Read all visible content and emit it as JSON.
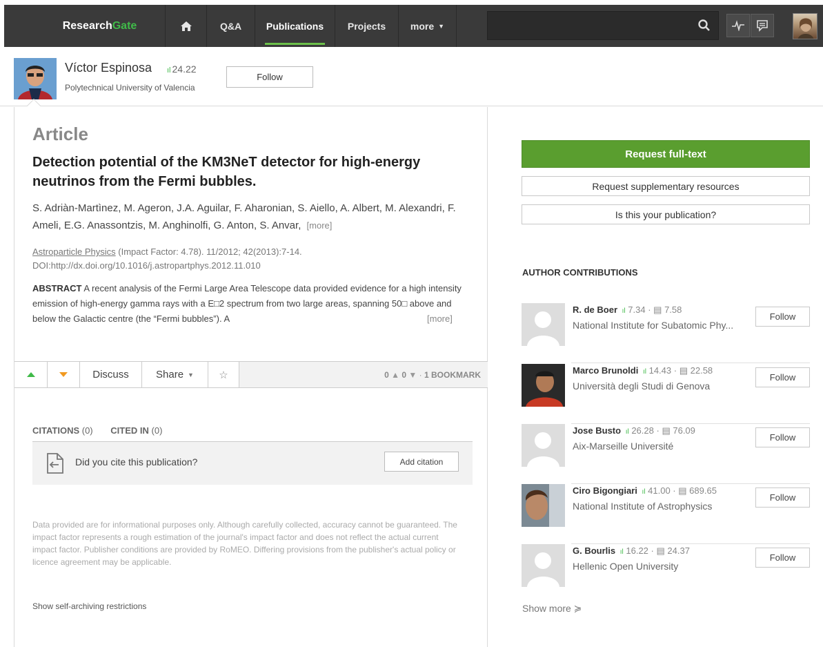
{
  "nav": {
    "brand_a": "Research",
    "brand_b": "Gate",
    "home_icon": "home-icon",
    "qa": "Q&A",
    "publications": "Publications",
    "projects": "Projects",
    "more": "more",
    "search_placeholder": ""
  },
  "profile": {
    "name": "Víctor Espinosa",
    "score": "24.22",
    "affiliation": "Polytechnical University of Valencia",
    "follow": "Follow"
  },
  "article": {
    "kind": "Article",
    "title": "Detection potential of the KM3NeT detector for high-energy neutrinos from the Fermi bubbles.",
    "authors": "S. Adriàn-Martìnez, M. Ageron, J.A. Aguilar, F. Aharonian, S. Aiello, A. Albert, M. Alexandri, F. Ameli, E.G. Anassontzis, M. Anghinolfi, G. Anton, S. Anvar,",
    "authors_more": "[more]",
    "journal_link": "Astroparticle Physics",
    "journal_rest": " (Impact Factor: 4.78). 11/2012; 42(2013):7-14.",
    "doi": "DOI:http://dx.doi.org/10.1016/j.astropartphys.2012.11.010",
    "abstract_label": "ABSTRACT",
    "abstract_text": " A recent analysis of the Fermi Large Area Telescope data provided evidence for a high intensity emission of high-energy gamma rays with a E□2 spectrum from two large areas, spanning 50□ above and below the Galactic centre (the “Fermi bubbles”). A",
    "abstract_more": "[more]"
  },
  "actions": {
    "discuss": "Discuss",
    "share": "Share",
    "up_count": "0",
    "down_count": "0",
    "bookmarks": "1 BOOKMARK"
  },
  "citations": {
    "tab1_label": "CITATIONS",
    "tab1_count": "(0)",
    "tab2_label": "CITED IN",
    "tab2_count": "(0)",
    "question": "Did you cite this publication?",
    "add": "Add citation"
  },
  "disclaimer": "Data provided are for informational purposes only. Although carefully collected, accuracy cannot be guaranteed. The impact factor represents a rough estimation of the journal's impact factor and does not reflect the actual current impact factor. Publisher conditions are provided by RoMEO. Differing provisions from the publisher's actual policy or licence agreement may be applicable.",
  "self_archiving": "Show self-archiving restrictions",
  "sidebar": {
    "request_full": "Request full-text",
    "request_supp": "Request supplementary resources",
    "is_yours": "Is this your publication?",
    "contrib_head": "AUTHOR CONTRIBUTIONS",
    "contributors": [
      {
        "name": "R. de Boer",
        "rg": "7.34",
        "pubs": "7.58",
        "affiliation": "National Institute for Subatomic Phy...",
        "follow": "Follow"
      },
      {
        "name": "Marco Brunoldi",
        "rg": "14.43",
        "pubs": "22.58",
        "affiliation": "Università degli Studi di Genova",
        "follow": "Follow"
      },
      {
        "name": "Jose Busto",
        "rg": "26.28",
        "pubs": "76.09",
        "affiliation": "Aix-Marseille Université",
        "follow": "Follow"
      },
      {
        "name": "Ciro Bigongiari",
        "rg": "41.00",
        "pubs": "689.65",
        "affiliation": "National Institute of Astrophysics",
        "follow": "Follow"
      },
      {
        "name": "G. Bourlis",
        "rg": "16.22",
        "pubs": "24.37",
        "affiliation": "Hellenic Open University",
        "follow": "Follow"
      }
    ],
    "show_more": "Show more"
  }
}
